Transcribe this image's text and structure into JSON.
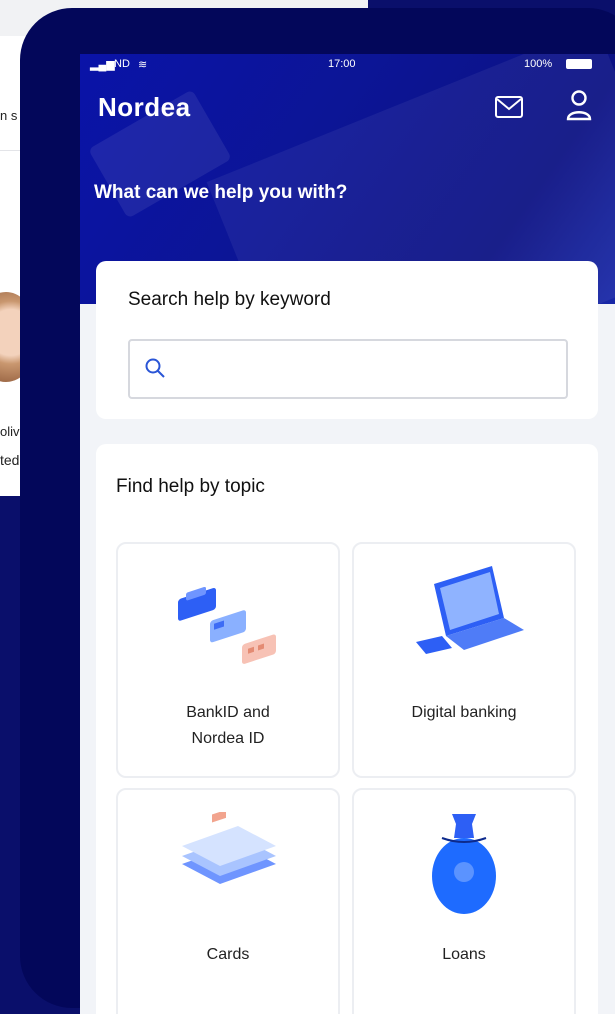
{
  "background": {
    "fragment_top": "n s",
    "fragment_mid1": "oliv",
    "fragment_mid2": "ted"
  },
  "status_bar": {
    "carrier": "ND",
    "time": "17:00",
    "battery": "100%"
  },
  "header": {
    "brand": "Nordea",
    "title": "What can we help you with?"
  },
  "search": {
    "label": "Search help by keyword",
    "placeholder": ""
  },
  "topics": {
    "label": "Find help by topic",
    "items": [
      {
        "label": "BankID and Nordea ID",
        "icon": "id-cards-illustration"
      },
      {
        "label": "Digital banking",
        "icon": "laptop-illustration"
      },
      {
        "label": "Cards",
        "icon": "cards-illustration"
      },
      {
        "label": "Loans",
        "icon": "money-bag-illustration"
      }
    ]
  },
  "colors": {
    "brand_blue": "#0b1594",
    "accent_blue": "#1e6bff",
    "background": "#0a0f6b"
  }
}
